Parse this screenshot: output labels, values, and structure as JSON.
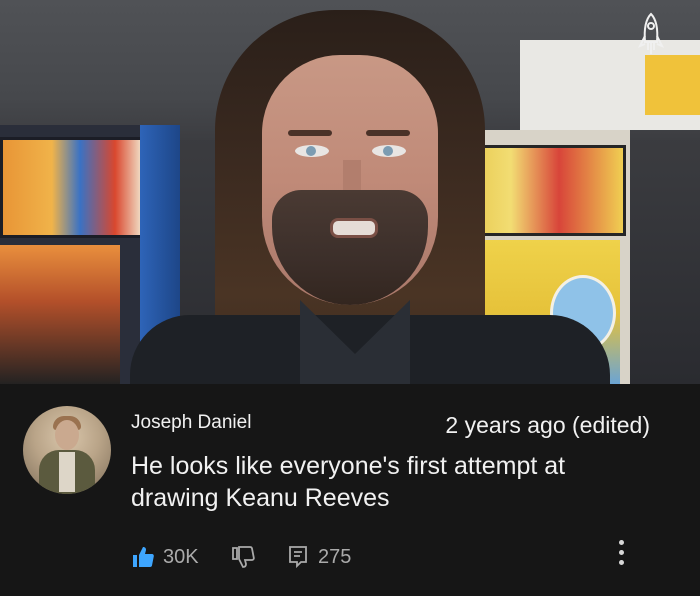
{
  "comment": {
    "author": "Joseph Daniel",
    "time": "2 years ago (edited)",
    "text": "He looks like everyone's first attempt at drawing Keanu Reeves",
    "likes": "30K",
    "replies": "275"
  },
  "icons": {
    "like": "thumbs-up-icon",
    "dislike": "thumbs-down-icon",
    "reply": "comment-icon",
    "more": "more-vert-icon",
    "logo": "rocket-logo-icon"
  },
  "colors": {
    "background": "#161616",
    "text": "#f1f1f1",
    "muted": "#aaaaaa",
    "like_accent": "#3ea6ff"
  }
}
